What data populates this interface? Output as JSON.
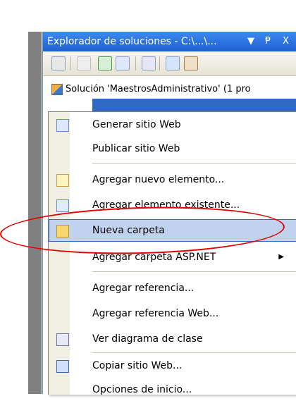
{
  "panel": {
    "title": "Explorador de soluciones - C:\\...\\...",
    "controls": {
      "dropdown": "▼",
      "pin": "Ᵽ",
      "close": "X"
    }
  },
  "toolbar": {
    "buttons": [
      {
        "icon": "properties-icon"
      },
      {
        "icon": "show-all-files-icon"
      },
      {
        "icon": "refresh-icon"
      },
      {
        "icon": "nest-related-files-icon"
      },
      {
        "icon": "view-class-diagram-icon"
      },
      {
        "icon": "copy-web-site-icon"
      },
      {
        "icon": "asp-net-configuration-icon"
      }
    ]
  },
  "tree": {
    "solution_label": "Solución 'MaestrosAdministrativo' (1 pro"
  },
  "context_menu": {
    "items": [
      {
        "label": "Generar sitio Web",
        "icon": "build-site-icon"
      },
      {
        "label": "Publicar sitio Web",
        "icon": ""
      },
      {
        "label": "Agregar nuevo elemento...",
        "icon": "add-new-item-icon"
      },
      {
        "label": "Agregar elemento existente...",
        "icon": "add-existing-item-icon"
      },
      {
        "label": "Nueva carpeta",
        "icon": "new-folder-icon",
        "highlighted": true
      },
      {
        "label": "Agregar carpeta ASP.NET",
        "icon": "",
        "has_submenu": true
      },
      {
        "label": "Agregar referencia...",
        "icon": ""
      },
      {
        "label": "Agregar referencia Web...",
        "icon": ""
      },
      {
        "label": "Ver diagrama de clase",
        "icon": "class-diagram-icon"
      },
      {
        "label": "Copiar sitio Web...",
        "icon": "copy-web-site-icon"
      },
      {
        "label": "Opciones de inicio...",
        "icon": ""
      }
    ]
  },
  "colors": {
    "titlebar": "#2a6fe0",
    "highlight": "#c1d2ee",
    "annotation": "#e00000"
  }
}
